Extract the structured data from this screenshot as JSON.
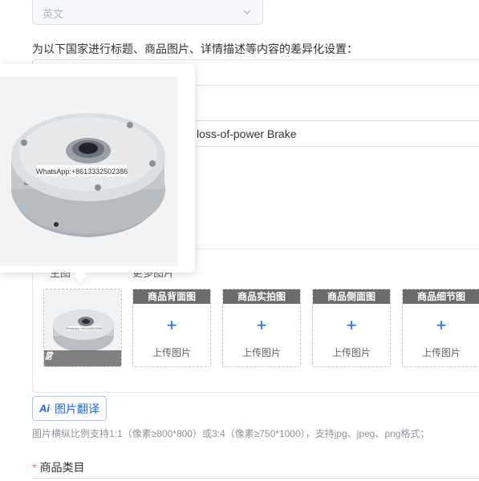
{
  "language_select": {
    "value": "英文"
  },
  "diff_label": "为以下国家进行标题、商品图片、详情描述等内容的差异化设置：",
  "title_row": {
    "text": "ic loss-of-power Brake"
  },
  "image_tabs": {
    "main": "主图",
    "more": "更多图片"
  },
  "preview": {
    "watermark": "WhatsApp:+8613332502386"
  },
  "thumb_watermark": "WhatsApp:+8613332502386",
  "slots": [
    {
      "caption": "商品背面图",
      "upload": "上传图片"
    },
    {
      "caption": "商品实拍图",
      "upload": "上传图片"
    },
    {
      "caption": "商品侧面图",
      "upload": "上传图片"
    },
    {
      "caption": "商品细节图",
      "upload": "上传图片"
    }
  ],
  "translate_button": {
    "icon": "Ai",
    "label": "图片翻译"
  },
  "hint": "图片横纵比例支持1:1（像素≥800*800）或3:4（像素≥750*1000），支持jpg、jpeg、png格式；",
  "category": {
    "required": "*",
    "label": "商品类目"
  },
  "colors": {
    "accent": "#1a66ff",
    "caption_bg": "#6b6b6b",
    "required": "#f56c6c"
  }
}
